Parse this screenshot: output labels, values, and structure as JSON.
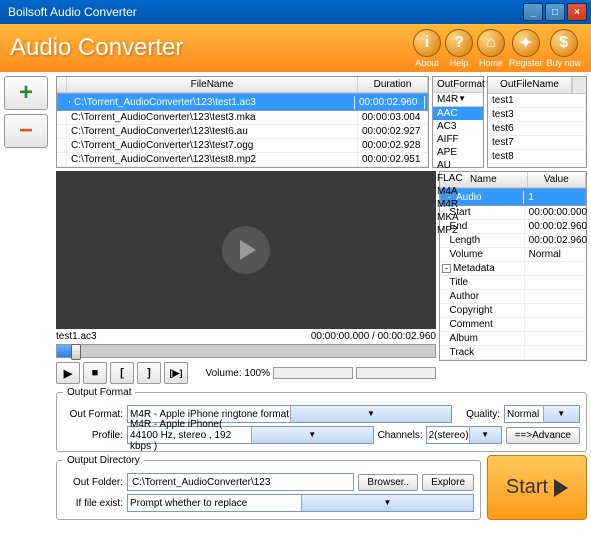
{
  "window": {
    "title": "Boilsoft Audio Converter"
  },
  "header": {
    "title": "Audio Converter",
    "buttons": [
      {
        "label": "About",
        "icon": "i"
      },
      {
        "label": "Help",
        "icon": "?"
      },
      {
        "label": "Home",
        "icon": "⌂"
      },
      {
        "label": "Register",
        "icon": "✦"
      },
      {
        "label": "Buy now",
        "icon": "$"
      }
    ]
  },
  "file_table": {
    "headers": {
      "filename": "FileName",
      "duration": "Duration",
      "outformat": "OutFormat",
      "outfilename": "OutFileName"
    },
    "rows": [
      {
        "filename": "C:\\Torrent_AudioConverter\\123\\test1.ac3",
        "duration": "00:00:02.960",
        "outformat": "M4R",
        "outfilename": "test1",
        "selected": true
      },
      {
        "filename": "C:\\Torrent_AudioConverter\\123\\test3.mka",
        "duration": "00:00:03.004",
        "outformat": "",
        "outfilename": "test3"
      },
      {
        "filename": "C:\\Torrent_AudioConverter\\123\\test6.au",
        "duration": "00:00:02.927",
        "outformat": "",
        "outfilename": "test6"
      },
      {
        "filename": "C:\\Torrent_AudioConverter\\123\\test7.ogg",
        "duration": "00:00:02.928",
        "outformat": "",
        "outfilename": "test7"
      },
      {
        "filename": "C:\\Torrent_AudioConverter\\123\\test8.mp2",
        "duration": "00:00:02.951",
        "outformat": "",
        "outfilename": "test8"
      }
    ]
  },
  "format_dropdown": {
    "options": [
      "AAC",
      "AC3",
      "AIFF",
      "APE",
      "AU",
      "FLAC",
      "M4A",
      "M4R",
      "MKA",
      "MP2"
    ],
    "highlighted": "AAC"
  },
  "properties": {
    "headers": {
      "name": "Name",
      "value": "Value"
    },
    "rows": [
      {
        "name": "Audio",
        "value": "1",
        "group": true,
        "selected": true
      },
      {
        "name": "Start",
        "value": "00:00:00.000"
      },
      {
        "name": "End",
        "value": "00:00:02.960"
      },
      {
        "name": "Length",
        "value": "00:00:02.960"
      },
      {
        "name": "Volume",
        "value": "Normal"
      },
      {
        "name": "Metadata",
        "value": "",
        "group": true
      },
      {
        "name": "Title",
        "value": ""
      },
      {
        "name": "Author",
        "value": ""
      },
      {
        "name": "Copyright",
        "value": ""
      },
      {
        "name": "Comment",
        "value": ""
      },
      {
        "name": "Album",
        "value": ""
      },
      {
        "name": "Track",
        "value": ""
      }
    ]
  },
  "player": {
    "current_file": "test1.ac3",
    "time": "00:00:00.000 / 00:00:02.960",
    "volume_label": "Volume:",
    "volume_pct": "100%"
  },
  "output_format": {
    "legend": "Output Format",
    "format_label": "Out Format:",
    "format_value": "M4R - Apple iPhone ringtone format",
    "profile_label": "Profile:",
    "profile_value": "M4R - Apple iPhone( 44100 Hz, stereo , 192 kbps )",
    "quality_label": "Quality:",
    "quality_value": "Normal",
    "channels_label": "Channels:",
    "channels_value": "2(stereo)",
    "advance_btn": "==>Advance"
  },
  "output_dir": {
    "legend": "Output Directory",
    "folder_label": "Out Folder:",
    "folder_value": "C:\\Torrent_AudioConverter\\123",
    "browse_btn": "Browser..",
    "explore_btn": "Explore",
    "exist_label": "If file exist:",
    "exist_value": "Prompt whether to replace"
  },
  "start_btn": "Start"
}
